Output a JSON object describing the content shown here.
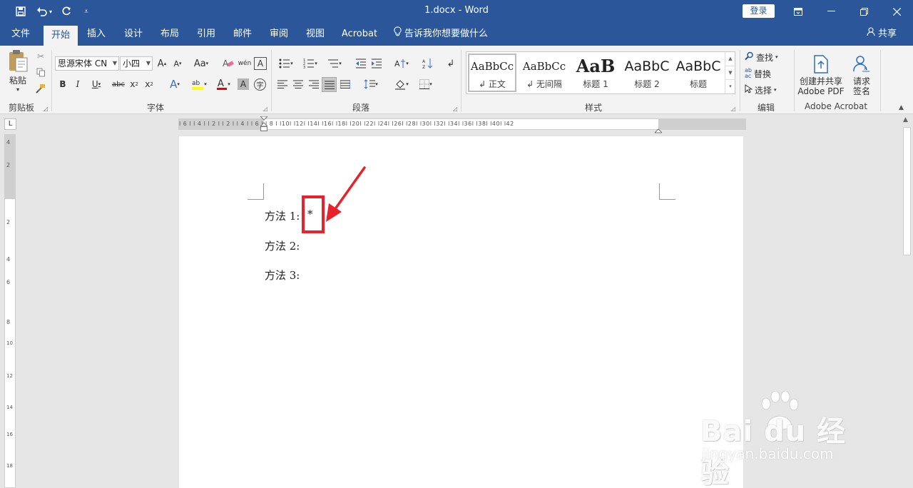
{
  "window": {
    "title": "1.docx  -  Word",
    "login_label": "登录"
  },
  "quick_access": {
    "save_icon": "save-icon",
    "undo_icon": "undo-icon",
    "redo_icon": "redo-icon",
    "customize_icon": "customize-icon"
  },
  "tabs": [
    {
      "label": "文件"
    },
    {
      "label": "开始"
    },
    {
      "label": "插入"
    },
    {
      "label": "设计"
    },
    {
      "label": "布局"
    },
    {
      "label": "引用"
    },
    {
      "label": "邮件"
    },
    {
      "label": "审阅"
    },
    {
      "label": "视图"
    },
    {
      "label": "Acrobat"
    }
  ],
  "tell_me": "告诉我你想要做什么",
  "share_label": "共享",
  "ribbon": {
    "clipboard": {
      "paste_label": "粘贴",
      "group_label": "剪贴板"
    },
    "font": {
      "font_name": "思源宋体 CN",
      "font_size": "小四",
      "group_label": "字体",
      "change_case": "Aa"
    },
    "paragraph": {
      "group_label": "段落"
    },
    "styles": {
      "group_label": "样式",
      "items": [
        {
          "preview": "AaBbCc",
          "name": "↲ 正文"
        },
        {
          "preview": "AaBbCc",
          "name": "↲ 无间隔"
        },
        {
          "preview": "AaB",
          "name": "标题 1"
        },
        {
          "preview": "AaBbC",
          "name": "标题 2"
        },
        {
          "preview": "AaBbC",
          "name": "标题"
        }
      ]
    },
    "editing": {
      "find": "查找",
      "replace": "替换",
      "select": "选择",
      "group_label": "编辑"
    },
    "acrobat": {
      "create_pdf_1": "创建并共享",
      "create_pdf_2": "Adobe PDF",
      "sign_1": "请求",
      "sign_2": "签名",
      "group_label": "Adobe Acrobat"
    }
  },
  "ruler": {
    "h_ticks": "l 6 l   l 4 l   l 2 l        l 2 l   l 4 l   l 6 l   l 8 l  l10l  l12l  l14l  l16l  l18l  l20l  l22l  l24l  l26l  l28l  l30l  l32l  l34l  l36l  l38l  l40l  l42",
    "v_ticks": [
      "4",
      "2",
      "2",
      "4",
      "6",
      "8",
      "10",
      "12",
      "14",
      "16",
      "18"
    ]
  },
  "document": {
    "lines": [
      "方法 1:",
      "方法 2:",
      "方法 3:"
    ],
    "inserted_symbol": "*",
    "annotation_color": "#e8212b"
  },
  "watermark": {
    "brand": "Bai du 经验",
    "sub": "jingyan.baidu.com"
  }
}
